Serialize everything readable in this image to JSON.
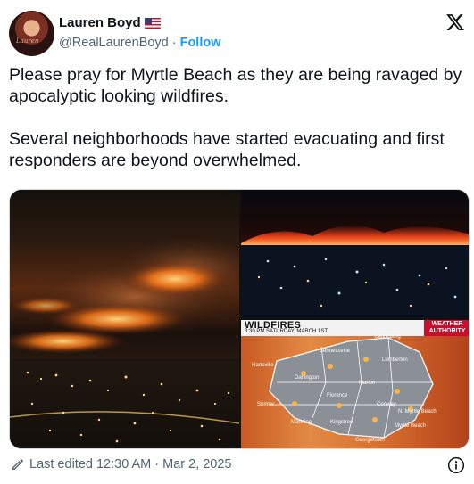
{
  "author": {
    "display_name": "Lauren Boyd",
    "handle": "@RealLaurenBoyd",
    "follow_label": "Follow",
    "flag": "us-flag-icon"
  },
  "tweet": {
    "paragraphs": [
      "Please pray for Myrtle Beach as they are being ravaged by apocalyptic looking wildfires.",
      "Several neighborhoods have started evacuating and first responders are beyond overwhelmed."
    ]
  },
  "media": {
    "weather_graphic": {
      "title": "WILDFIRES",
      "subtitle": "3:30 PM SATURDAY, MARCH 1ST",
      "alert_line1": "WEATHER",
      "alert_line2": "AUTHORITY",
      "places": [
        "Laurinburg",
        "Bennettsville",
        "Lumberton",
        "Hartsville",
        "Darlington",
        "Marion",
        "Florence",
        "Sumter",
        "Conway",
        "N. Myrtle Beach",
        "Manning",
        "Kingstree",
        "Myrtle Beach",
        "Georgetown"
      ]
    }
  },
  "footer": {
    "edited_label": "Last edited 12:30 AM · Mar 2, 2025"
  },
  "colors": {
    "accent": "#1d9bf0",
    "secondary_text": "#536471",
    "fire": "#ff6a1a"
  }
}
